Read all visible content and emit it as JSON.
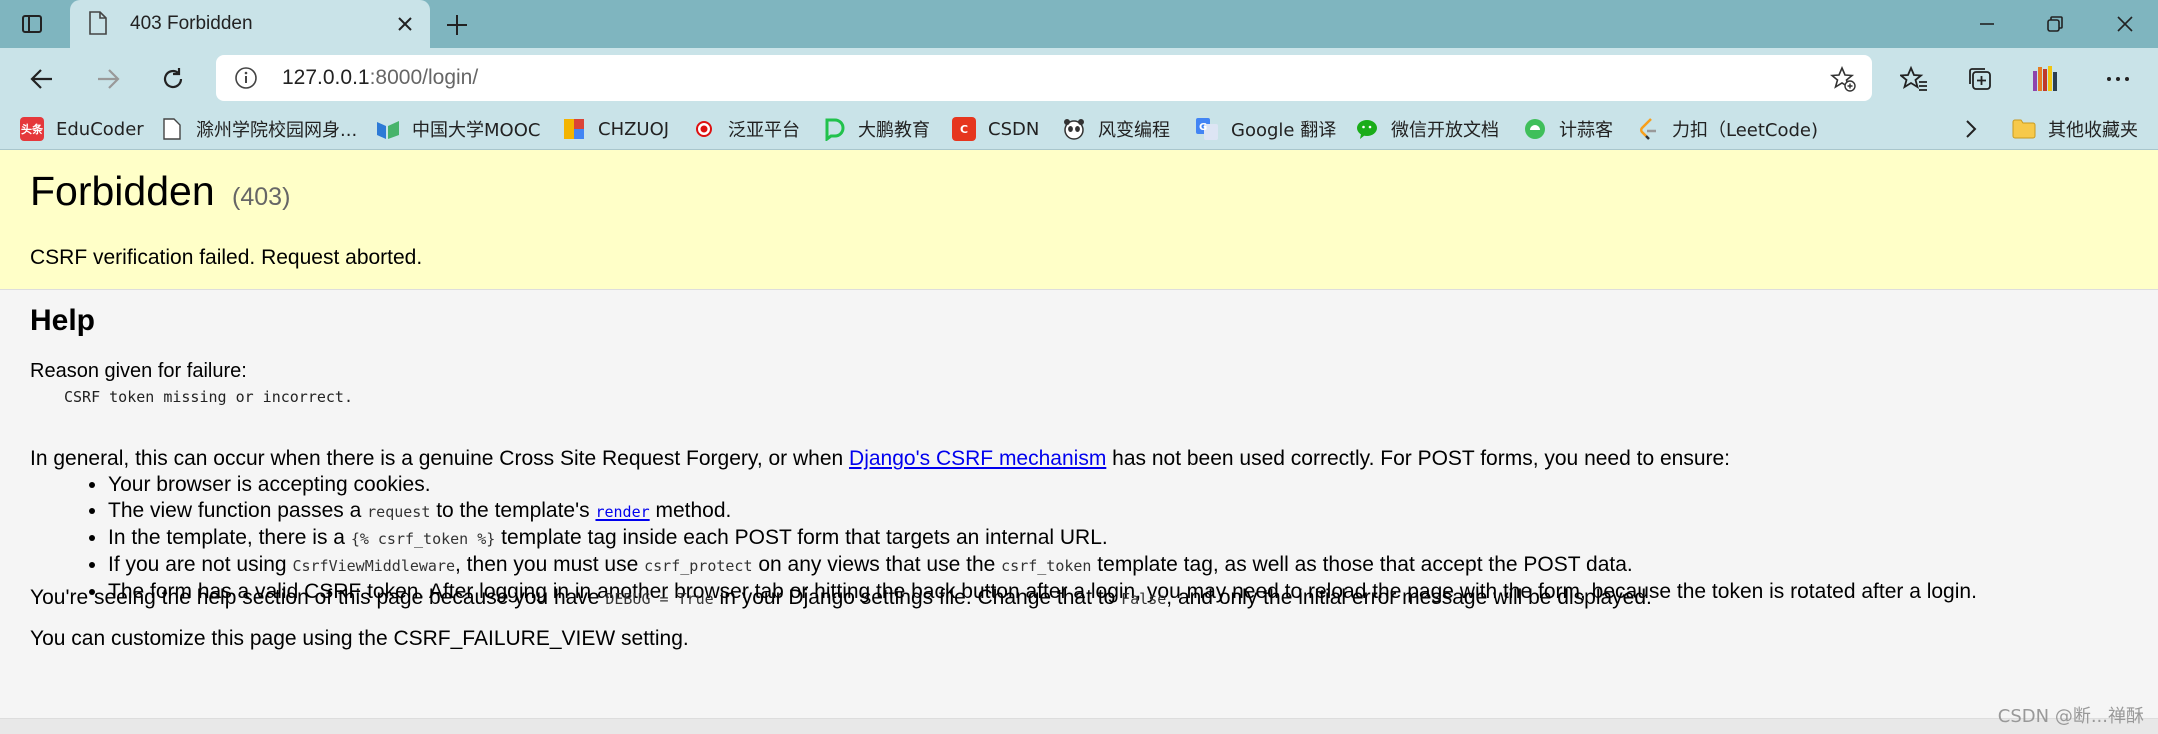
{
  "tab": {
    "title": "403 Forbidden"
  },
  "address": {
    "host": "127.0.0.1",
    "rest": ":8000/login/"
  },
  "bookmarks": [
    {
      "label": "EduCoder",
      "icon": "toutiao-icon",
      "color": "#e5383b",
      "glyph": "头条"
    },
    {
      "label": "滁州学院校园网身...",
      "icon": "page-icon",
      "color": "#ffffff",
      "glyph": ""
    },
    {
      "label": "中国大学MOOC",
      "icon": "mooc-icon",
      "color": "#3a7bd5",
      "glyph": ""
    },
    {
      "label": "CHZUOJ",
      "icon": "chzuoj-icon",
      "color": "#f4b400",
      "glyph": ""
    },
    {
      "label": "泛亚平台",
      "icon": "fanya-icon",
      "color": "#d11",
      "glyph": ""
    },
    {
      "label": "大鹏教育",
      "icon": "dapeng-icon",
      "color": "#21c24c",
      "glyph": "D"
    },
    {
      "label": "CSDN",
      "icon": "csdn-icon",
      "color": "#e6361e",
      "glyph": "C"
    },
    {
      "label": "风变编程",
      "icon": "panda-icon",
      "color": "#444444",
      "glyph": ""
    },
    {
      "label": "Google 翻译",
      "icon": "google-translate-icon",
      "color": "#4285f4",
      "glyph": "G"
    },
    {
      "label": "微信开放文档",
      "icon": "wechat-icon",
      "color": "#1aad19",
      "glyph": ""
    },
    {
      "label": "计蒜客",
      "icon": "jisuanke-icon",
      "color": "#3fbf5a",
      "glyph": ""
    },
    {
      "label": "力扣（LeetCode)",
      "icon": "leetcode-icon",
      "color": "#f89f1b",
      "glyph": ""
    }
  ],
  "bookmarks_other": "其他收藏夹",
  "page": {
    "title": "Forbidden",
    "code": "(403)",
    "summary": "CSRF verification failed. Request aborted.",
    "help_heading": "Help",
    "reason_label": "Reason given for failure:",
    "reason": "CSRF token missing or incorrect.",
    "general_pre": "In general, this can occur when there is a genuine Cross Site Request Forgery, or when ",
    "general_link": "Django's CSRF mechanism",
    "general_post": " has not been used correctly. For POST forms, you need to ensure:",
    "li1": "Your browser is accepting cookies.",
    "li2_a": "The view function passes a ",
    "li2_code": "request",
    "li2_b": " to the template's ",
    "li2_link": "render",
    "li2_c": " method.",
    "li3_a": "In the template, there is a ",
    "li3_code": "{% csrf_token %}",
    "li3_b": " template tag inside each POST form that targets an internal URL.",
    "li4_a": "If you are not using ",
    "li4_code1": "CsrfViewMiddleware",
    "li4_b": ", then you must use ",
    "li4_code2": "csrf_protect",
    "li4_c": " on any views that use the ",
    "li4_code3": "csrf_token",
    "li4_d": " template tag, as well as those that accept the POST data.",
    "li5": "The form has a valid CSRF token. After logging in in another browser tab or hitting the back button after a login, you may need to reload the page with the form, because the token is rotated after a login.",
    "debug_a": "You're seeing the help section of this page because you have ",
    "debug_code": "DEBUG = True",
    "debug_b": " in your Django settings file. Change that to ",
    "debug_code2": "False",
    "debug_c": ", and only the initial error message will be displayed.",
    "customize": "You can customize this page using the CSRF_FAILURE_VIEW setting."
  },
  "watermark": "CSDN @断...禅酥"
}
